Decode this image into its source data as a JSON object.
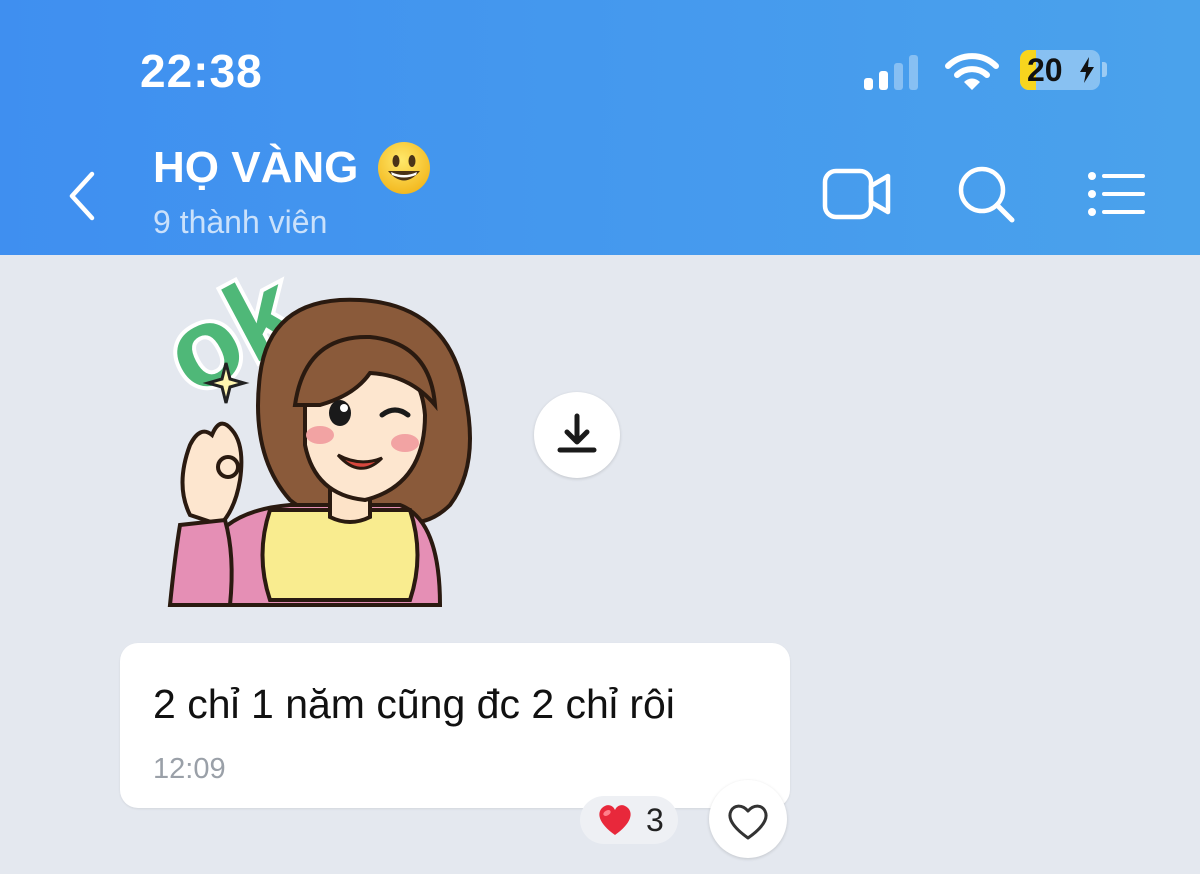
{
  "status_bar": {
    "time": "22:38",
    "battery_percent": "20",
    "battery_level": 0.2,
    "signal_bars_active": 2,
    "signal_bars_total": 4,
    "icons": [
      "signal-icon",
      "wifi-icon",
      "battery-icon",
      "charging-bolt-icon"
    ]
  },
  "header": {
    "title": "HỌ VÀNG",
    "title_emoji": "smiley-emoji-icon",
    "subtitle": "9 thành viên",
    "icons": [
      "back-icon",
      "video-call-icon",
      "search-icon",
      "menu-list-icon"
    ]
  },
  "sticker": {
    "lettering": "ok",
    "description_icon": "ok-girl-sticker",
    "download_icon": "download-icon"
  },
  "message": {
    "text": "2 chỉ 1 năm cũng đc 2 chỉ rôi",
    "time": "12:09"
  },
  "reaction": {
    "emoji": "red-heart-icon",
    "count": "3",
    "like_icon": "heart-outline-icon"
  },
  "colors": {
    "header_start": "#3f8ff0",
    "header_end": "#4aa2ec",
    "background": "#e4e8ef",
    "battery": "#f7d51e",
    "reaction_heart": "#e8283b"
  }
}
